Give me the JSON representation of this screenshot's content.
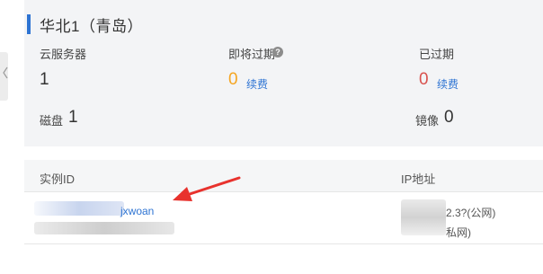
{
  "region": {
    "title": "华北1（青岛）"
  },
  "stats": {
    "ecs": {
      "label": "云服务器",
      "value": "1"
    },
    "expiring": {
      "label": "即将过期",
      "value": "0",
      "renew_label": "续费",
      "value_color": "#f5a623"
    },
    "expired": {
      "label": "已过期",
      "value": "0",
      "renew_label": "续费",
      "value_color": "#d9534f"
    },
    "disk": {
      "label": "磁盘",
      "value": "1"
    },
    "image": {
      "label": "镜像",
      "value": "0"
    }
  },
  "table": {
    "columns": [
      "实例ID",
      "IP地址"
    ],
    "rows": [
      {
        "instance_id_visible": "jxwoan",
        "ip_public_suffix": "2.3?(公网)",
        "ip_private_suffix": "私网)"
      }
    ]
  },
  "colors": {
    "accent": "#2e74d3",
    "link": "#2e74d3",
    "arrow": "#e8322d"
  },
  "icons": {
    "help": "question-circle-icon",
    "collapse": "chevron-left-icon",
    "annotation": "red-arrow-icon"
  }
}
